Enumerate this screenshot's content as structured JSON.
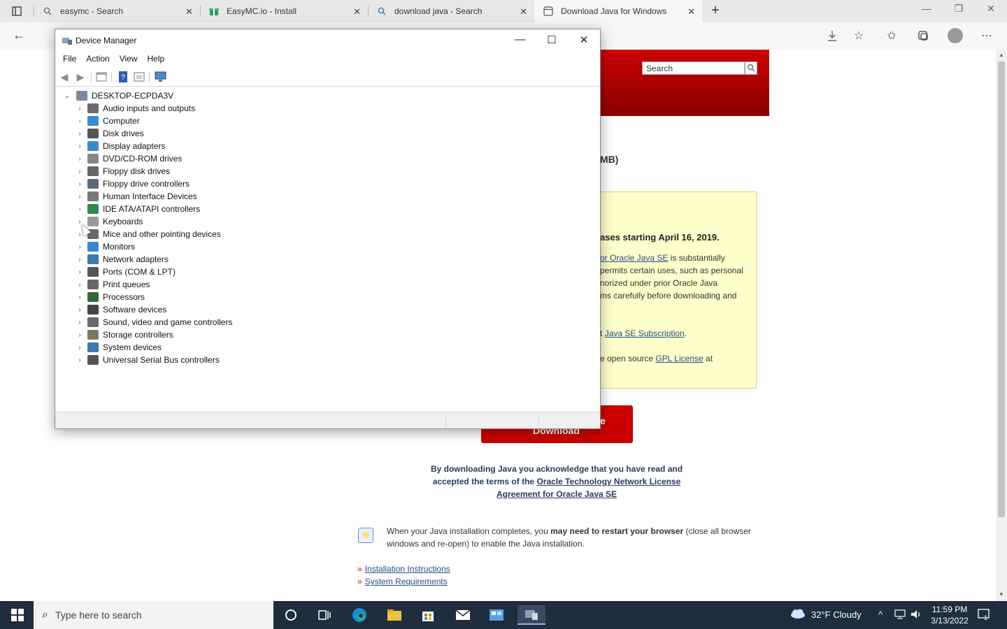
{
  "browser": {
    "tabs": [
      {
        "title": "easymc - Search",
        "icon": "search-icon",
        "active": false
      },
      {
        "title": "EasyMC.io - Install",
        "icon": "gift-icon",
        "active": false
      },
      {
        "title": "download java - Search",
        "icon": "search-icon",
        "active": false
      },
      {
        "title": "Download Java for Windows",
        "icon": "page-icon",
        "active": true
      }
    ]
  },
  "page": {
    "search_placeholder": "Search",
    "size_fragment": "MB)",
    "notice": {
      "heading": "ases starting April 16, 2019.",
      "line1_link": "or Oracle Java SE",
      "line1_rest": "is substantially",
      "line2": "permits certain uses, such as personal",
      "line3": "norized under prior Oracle Java",
      "line4": "ms carefully before downloading and",
      "line5_pre": "t",
      "line5_link": "Java SE Subscription",
      "line5_post": ".",
      "line6_pre": "e open source",
      "line6_link": "GPL License",
      "line6_post": "at"
    },
    "download_button": {
      "line1": "e",
      "line2": "Download"
    },
    "acknowledge": {
      "text1": "By downloading Java you acknowledge that you have read and",
      "text2": "accepted the terms of the",
      "link": "Oracle Technology Network License Agreement for Oracle Java SE"
    },
    "tip": {
      "pre": "When your Java installation completes, you",
      "bold": "may need to restart your browser",
      "post": "(close all browser windows and re-open) to enable the Java installation."
    },
    "links": [
      "Installation Instructions",
      "System Requirements"
    ],
    "bullet_glyph": "»"
  },
  "device_manager": {
    "title": "Device Manager",
    "menu": [
      "File",
      "Action",
      "View",
      "Help"
    ],
    "root": "DESKTOP-ECPDA3V",
    "categories": [
      {
        "label": "Audio inputs and outputs",
        "color": "#6a6a6a"
      },
      {
        "label": "Computer",
        "color": "#3a8ad0"
      },
      {
        "label": "Disk drives",
        "color": "#555555"
      },
      {
        "label": "Display adapters",
        "color": "#3a8ad0"
      },
      {
        "label": "DVD/CD-ROM drives",
        "color": "#888888"
      },
      {
        "label": "Floppy disk drives",
        "color": "#666666"
      },
      {
        "label": "Floppy drive controllers",
        "color": "#5a6a7a"
      },
      {
        "label": "Human Interface Devices",
        "color": "#7a7a7a"
      },
      {
        "label": "IDE ATA/ATAPI controllers",
        "color": "#2f8a4a"
      },
      {
        "label": "Keyboards",
        "color": "#9a9a9a"
      },
      {
        "label": "Mice and other pointing devices",
        "color": "#6a6a6a"
      },
      {
        "label": "Monitors",
        "color": "#3a8ad0"
      },
      {
        "label": "Network adapters",
        "color": "#3a7ab0"
      },
      {
        "label": "Ports (COM & LPT)",
        "color": "#555555"
      },
      {
        "label": "Print queues",
        "color": "#666666"
      },
      {
        "label": "Processors",
        "color": "#2f6a3a"
      },
      {
        "label": "Software devices",
        "color": "#444444"
      },
      {
        "label": "Sound, video and game controllers",
        "color": "#6a6a6a"
      },
      {
        "label": "Storage controllers",
        "color": "#7a7a5a"
      },
      {
        "label": "System devices",
        "color": "#3a7ab0"
      },
      {
        "label": "Universal Serial Bus controllers",
        "color": "#555555"
      }
    ]
  },
  "taskbar": {
    "search_placeholder": "Type here to search",
    "weather": "32°F  Cloudy",
    "time": "11:59 PM",
    "date": "3/13/2022"
  }
}
